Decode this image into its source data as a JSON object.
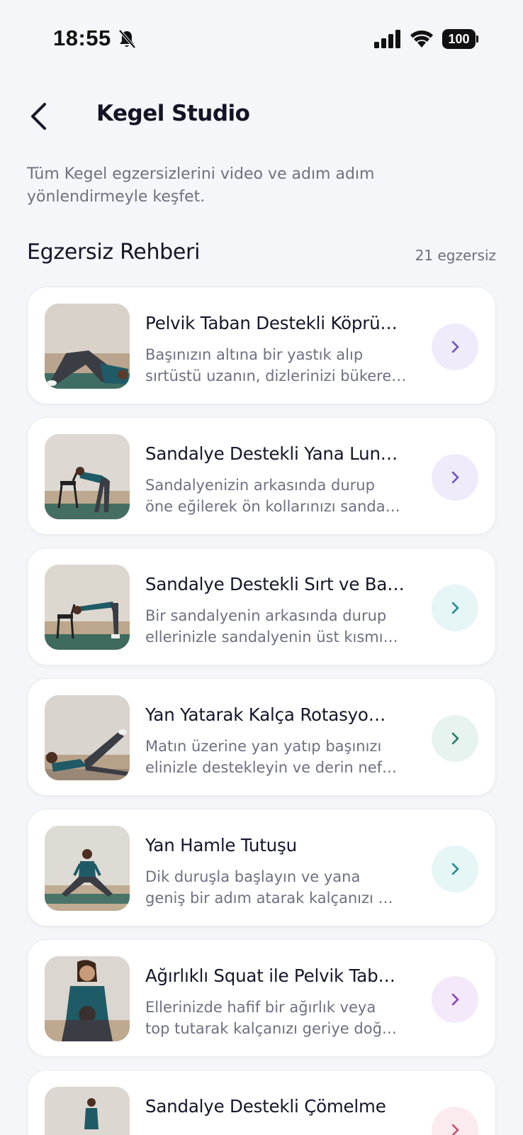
{
  "status_bar": {
    "time": "18:55",
    "battery": "100",
    "icons": [
      "bell-off-icon",
      "signal-icon",
      "wifi-icon",
      "battery-icon"
    ]
  },
  "header": {
    "title": "Kegel Studio",
    "back_icon": "chevron-left-icon"
  },
  "subtitle": "Tüm Kegel egzersizlerini video ve adım adım yönlendirmeyle keşfet.",
  "section": {
    "title": "Egzersiz Rehberi",
    "count": "21 egzersiz"
  },
  "exercises": [
    {
      "title": "Pelvik Taban Destekli Köprü…",
      "desc_line1": "Başınızın altına bir yastık alıp",
      "desc_line2": "sırtüstü uzanın, dizlerinizi bükere…",
      "accent": "#6b4fc9",
      "accent_bg": "#efebfb"
    },
    {
      "title": "Sandalye Destekli Yana Lun…",
      "desc_line1": "Sandalyenizin arkasında durup",
      "desc_line2": "öne eğilerek ön kollarınızı sanda…",
      "accent": "#6b4fc9",
      "accent_bg": "#efebfb"
    },
    {
      "title": "Sandalye Destekli Sırt ve Ba…",
      "desc_line1": "Bir sandalyenin arkasında durup",
      "desc_line2": "ellerinizle sandalyenin üst kısmı…",
      "accent": "#1e8a96",
      "accent_bg": "#e6f5f6"
    },
    {
      "title": "Yan Yatarak Kalça Rotasyo…",
      "desc_line1": "Matın üzerine yan yatıp başınızı",
      "desc_line2": "elinizle destekleyin ve derin nef…",
      "accent": "#1f7a62",
      "accent_bg": "#e7f3ef"
    },
    {
      "title": "Yan Hamle Tutuşu",
      "desc_line1": "Dik duruşla başlayın ve yana",
      "desc_line2": "geniş bir adım atarak kalçanızı …",
      "accent": "#1e8a96",
      "accent_bg": "#e6f5f6"
    },
    {
      "title": "Ağırlıklı Squat ile Pelvik Tab…",
      "desc_line1": "Ellerinizde hafif bir ağırlık veya",
      "desc_line2": "top tutarak kalçanızı geriye doğ…",
      "accent": "#8a3fc0",
      "accent_bg": "#f3e9fb"
    },
    {
      "title": "Sandalye Destekli Çömelme",
      "desc_line1": "",
      "desc_line2": "",
      "accent": "#c94f6b",
      "accent_bg": "#fbeaee"
    }
  ]
}
